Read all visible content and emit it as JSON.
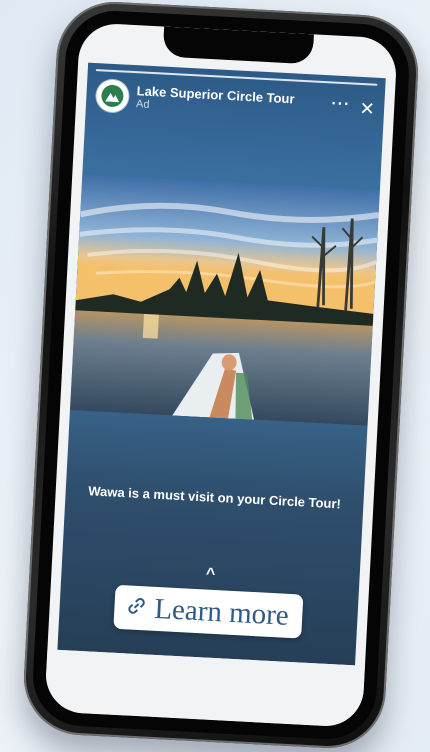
{
  "story": {
    "brand_name": "Lake Superior Circle Tour",
    "ad_label": "Ad",
    "more_icon": "more-dots-icon",
    "close_icon": "close-icon",
    "caption": "Wawa is a must visit on your Circle Tour!",
    "swipe_up_icon": "chevron-up-icon",
    "cta": {
      "label": "Learn more",
      "icon": "link-icon"
    }
  },
  "colors": {
    "story_top": "#2d5a86",
    "story_bottom": "#263f57",
    "cta_text": "#2d5a86",
    "brand_green": "#2e7d4f"
  }
}
